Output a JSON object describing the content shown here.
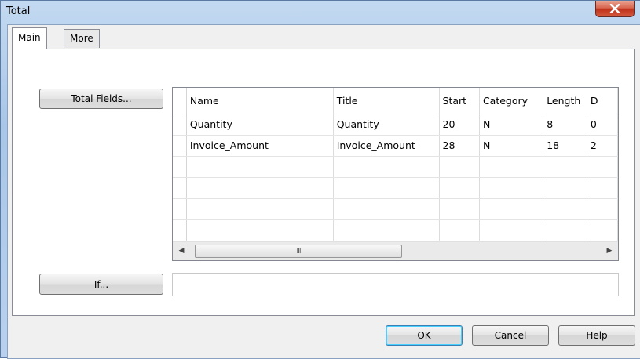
{
  "window": {
    "title": "Total",
    "close_icon": "close-icon"
  },
  "tabs": [
    {
      "label": "Main",
      "active": true
    },
    {
      "label": "More",
      "active": false
    }
  ],
  "main": {
    "total_fields_button": "Total Fields...",
    "if_button": "If...",
    "if_value": "",
    "grid": {
      "columns": [
        "Name",
        "Title",
        "Start",
        "Category",
        "Length",
        "D"
      ],
      "rows": [
        [
          "Quantity",
          "Quantity",
          "20",
          "N",
          "8",
          "0"
        ],
        [
          "Invoice_Amount",
          "Invoice_Amount",
          "28",
          "N",
          "18",
          "2"
        ]
      ],
      "scroll_thumb_label": "III"
    }
  },
  "footer": {
    "ok": "OK",
    "cancel": "Cancel",
    "help": "Help"
  }
}
